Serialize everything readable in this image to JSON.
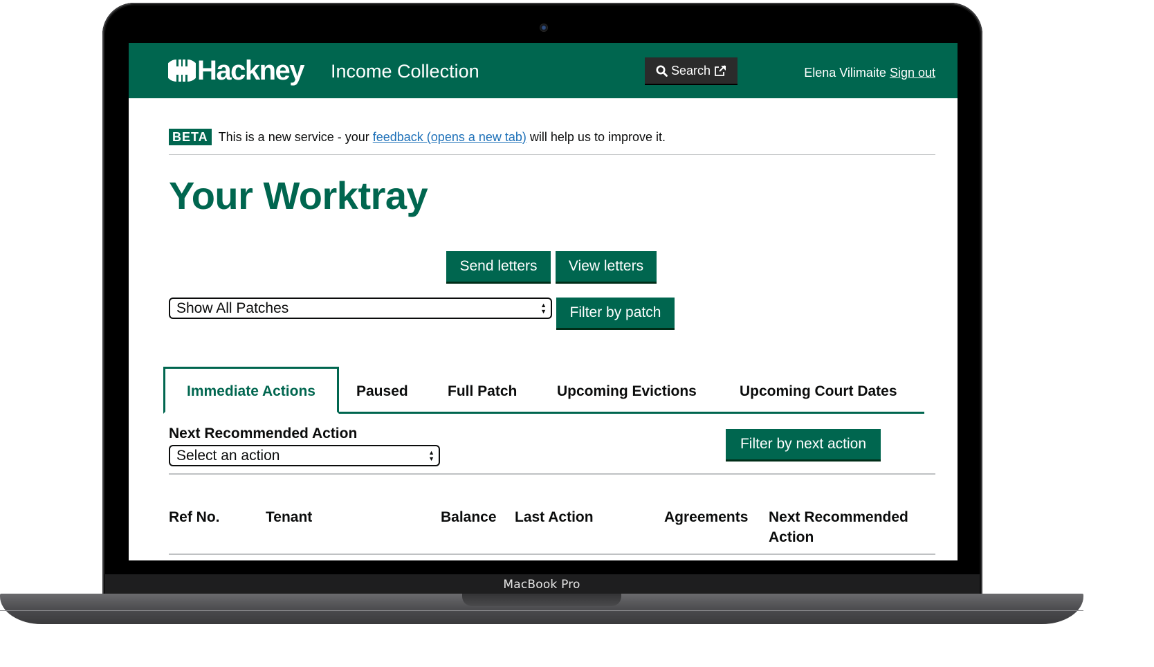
{
  "device": {
    "label": "MacBook Pro"
  },
  "header": {
    "logo_text": "Hackney",
    "service_name": "Income Collection",
    "search_label": "Search",
    "user_name": "Elena Vilimaite",
    "sign_out_label": "Sign out",
    "brand_color": "#00664f"
  },
  "beta_banner": {
    "tag": "BETA",
    "text_before": "This is a new service - your ",
    "link_text": "feedback (opens a new tab)",
    "text_after": " will help us to improve it."
  },
  "page": {
    "title": "Your Worktray"
  },
  "actions": {
    "send_letters": "Send letters",
    "view_letters": "View letters"
  },
  "patch_filter": {
    "selected": "Show All Patches",
    "button": "Filter by patch"
  },
  "tabs": [
    {
      "label": "Immediate Actions",
      "active": true
    },
    {
      "label": "Paused",
      "active": false
    },
    {
      "label": "Full Patch",
      "active": false
    },
    {
      "label": "Upcoming Evictions",
      "active": false
    },
    {
      "label": "Upcoming Court Dates",
      "active": false
    }
  ],
  "next_action_filter": {
    "label": "Next Recommended Action",
    "selected": "Select an action",
    "button": "Filter by next action"
  },
  "table": {
    "columns": [
      "Ref No.",
      "Tenant",
      "Balance",
      "Last Action",
      "Agreements",
      "Next Recommended",
      "Action"
    ]
  }
}
